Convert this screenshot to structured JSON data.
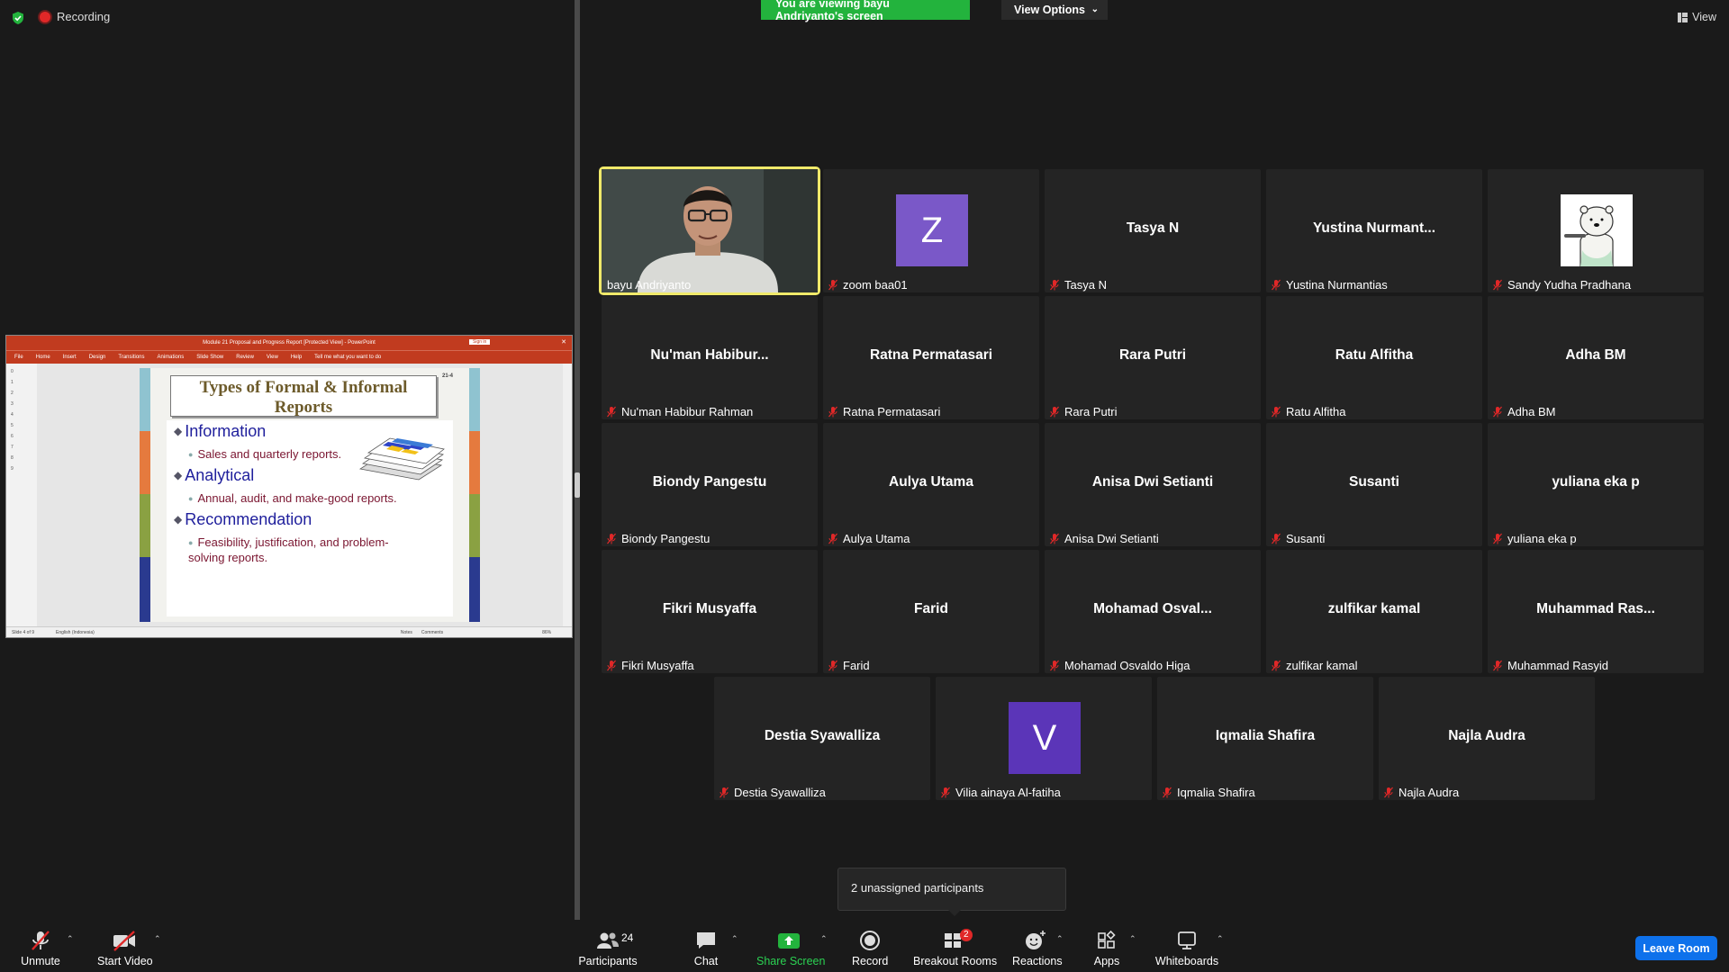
{
  "top": {
    "recording": "Recording",
    "banner": "You are viewing bayu Andriyanto's screen",
    "view_options": "View Options",
    "view": "View"
  },
  "powerpoint": {
    "title": "Module 21 Proposal and Progress Report [Protected View] - PowerPoint",
    "sign_in": "Sign in",
    "tabs": [
      "File",
      "Home",
      "Insert",
      "Design",
      "Transitions",
      "Animations",
      "Slide Show",
      "Review",
      "View",
      "Help"
    ],
    "tell_me": "Tell me what you want to do",
    "status_left": "Slide 4 of 9",
    "status_lang": "English (Indonesia)",
    "status_notes": "Notes",
    "status_comments": "Comments",
    "zoom": "86%",
    "thumb_numbers": [
      "0",
      "1",
      "2",
      "3",
      "4",
      "5",
      "6",
      "7",
      "8",
      "9"
    ]
  },
  "slide": {
    "title": "Types of Formal & Informal Reports",
    "number": "21-4",
    "sections": [
      {
        "heading": "Information",
        "item": "Sales and quarterly reports."
      },
      {
        "heading": "Analytical",
        "item": "Annual, audit, and make-good reports."
      },
      {
        "heading": "Recommendation",
        "item": "Feasibility, justification, and problem-solving reports."
      }
    ],
    "bar_colors": [
      "#8fc3d0",
      "#e57a3e",
      "#8aa142",
      "#2a3a8f"
    ]
  },
  "tiles": [
    {
      "name": "bayu Andriyanto",
      "type": "video",
      "active": true
    },
    {
      "name": "zoom baa01",
      "type": "avatar",
      "letter": "Z",
      "color": "#7a58c8"
    },
    {
      "name": "Tasya N",
      "display": "Tasya N",
      "type": "name"
    },
    {
      "name": "Yustina Nurmantias",
      "display": "Yustina  Nurmant...",
      "type": "name"
    },
    {
      "name": "Sandy Yudha Pradhana",
      "type": "bear"
    },
    {
      "name": "Nu'man Habibur Rahman",
      "display": "Nu'man  Habibur...",
      "type": "name"
    },
    {
      "name": "Ratna Permatasari",
      "display": "Ratna Permatasari",
      "type": "name"
    },
    {
      "name": "Rara Putri",
      "display": "Rara Putri",
      "type": "name"
    },
    {
      "name": "Ratu Alfitha",
      "display": "Ratu Alfitha",
      "type": "name"
    },
    {
      "name": "Adha BM",
      "display": "Adha BM",
      "type": "name"
    },
    {
      "name": "Biondy Pangestu",
      "display": "Biondy Pangestu",
      "type": "name"
    },
    {
      "name": "Aulya Utama",
      "display": "Aulya Utama",
      "type": "name"
    },
    {
      "name": "Anisa Dwi Setianti",
      "display": "Anisa Dwi Setianti",
      "type": "name"
    },
    {
      "name": "Susanti",
      "display": "Susanti",
      "type": "name"
    },
    {
      "name": "yuliana eka p",
      "display": "yuliana eka p",
      "type": "name"
    },
    {
      "name": "Fikri Musyaffa",
      "display": "Fikri Musyaffa",
      "type": "name"
    },
    {
      "name": "Farid",
      "display": "Farid",
      "type": "name"
    },
    {
      "name": "Mohamad Osvaldo Higa",
      "display": "Mohamad  Osval...",
      "type": "name"
    },
    {
      "name": "zulfikar kamal",
      "display": "zulfikar kamal",
      "type": "name"
    },
    {
      "name": "Muhammad Rasyid",
      "display": "Muhammad  Ras...",
      "type": "name"
    },
    {
      "name": "Destia Syawalliza",
      "display": "Destia Syawalliza",
      "type": "name"
    },
    {
      "name": "Vilia ainaya Al-fatiha",
      "type": "avatar",
      "letter": "V",
      "color": "#5b35b8"
    },
    {
      "name": "Iqmalia Shafira",
      "display": "Iqmalia Shafira",
      "type": "name"
    },
    {
      "name": "Najla Audra",
      "display": "Najla Audra",
      "type": "name"
    }
  ],
  "popup": {
    "unassigned": "2 unassigned participants"
  },
  "toolbar": {
    "unmute": "Unmute",
    "start_video": "Start Video",
    "participants": "Participants",
    "participants_count": "24",
    "chat": "Chat",
    "share_screen": "Share Screen",
    "record": "Record",
    "breakout_rooms": "Breakout Rooms",
    "breakout_badge": "2",
    "reactions": "Reactions",
    "apps": "Apps",
    "whiteboards": "Whiteboards",
    "leave_room": "Leave Room"
  },
  "colors": {
    "share_green": "#23b33d",
    "leave_blue": "#0e71eb",
    "active_speaker": "#f0e96a",
    "mic_red": "#e02828"
  }
}
